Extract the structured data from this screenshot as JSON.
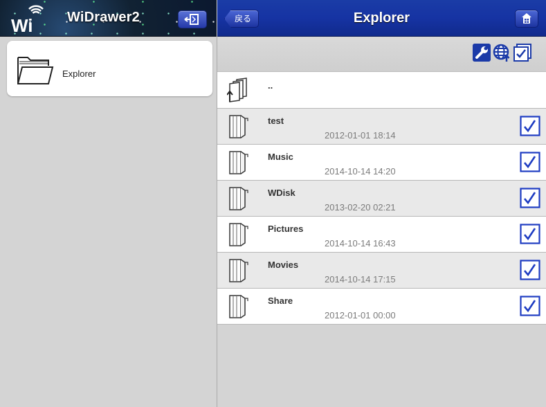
{
  "app": {
    "logo_text": "Wi",
    "title": "WiDrawer2"
  },
  "header": {
    "back_label": "戻る",
    "page_title": "Explorer"
  },
  "sidebar": {
    "items": [
      {
        "label": "Explorer",
        "icon": "folder-open-icon"
      }
    ]
  },
  "toolbar": {
    "icons": [
      "wrench-icon",
      "globe-upload-icon",
      "select-all-icon"
    ]
  },
  "file_list": {
    "parent": {
      "name": "..",
      "icon": "parent-folder-icon"
    },
    "items": [
      {
        "name": "test",
        "date": "2012-01-01 18:14",
        "checked": true
      },
      {
        "name": "Music",
        "date": "2014-10-14 14:20",
        "checked": true
      },
      {
        "name": "WDisk",
        "date": "2013-02-20 02:21",
        "checked": true
      },
      {
        "name": "Pictures",
        "date": "2014-10-14 16:43",
        "checked": true
      },
      {
        "name": "Movies",
        "date": "2014-10-14 17:15",
        "checked": true
      },
      {
        "name": "Share",
        "date": "2012-01-01 00:00",
        "checked": true
      }
    ]
  },
  "colors": {
    "header_blue": "#1633a3",
    "check_blue": "#1e3cc2",
    "sidebar_bg": "#d4d4d4"
  }
}
